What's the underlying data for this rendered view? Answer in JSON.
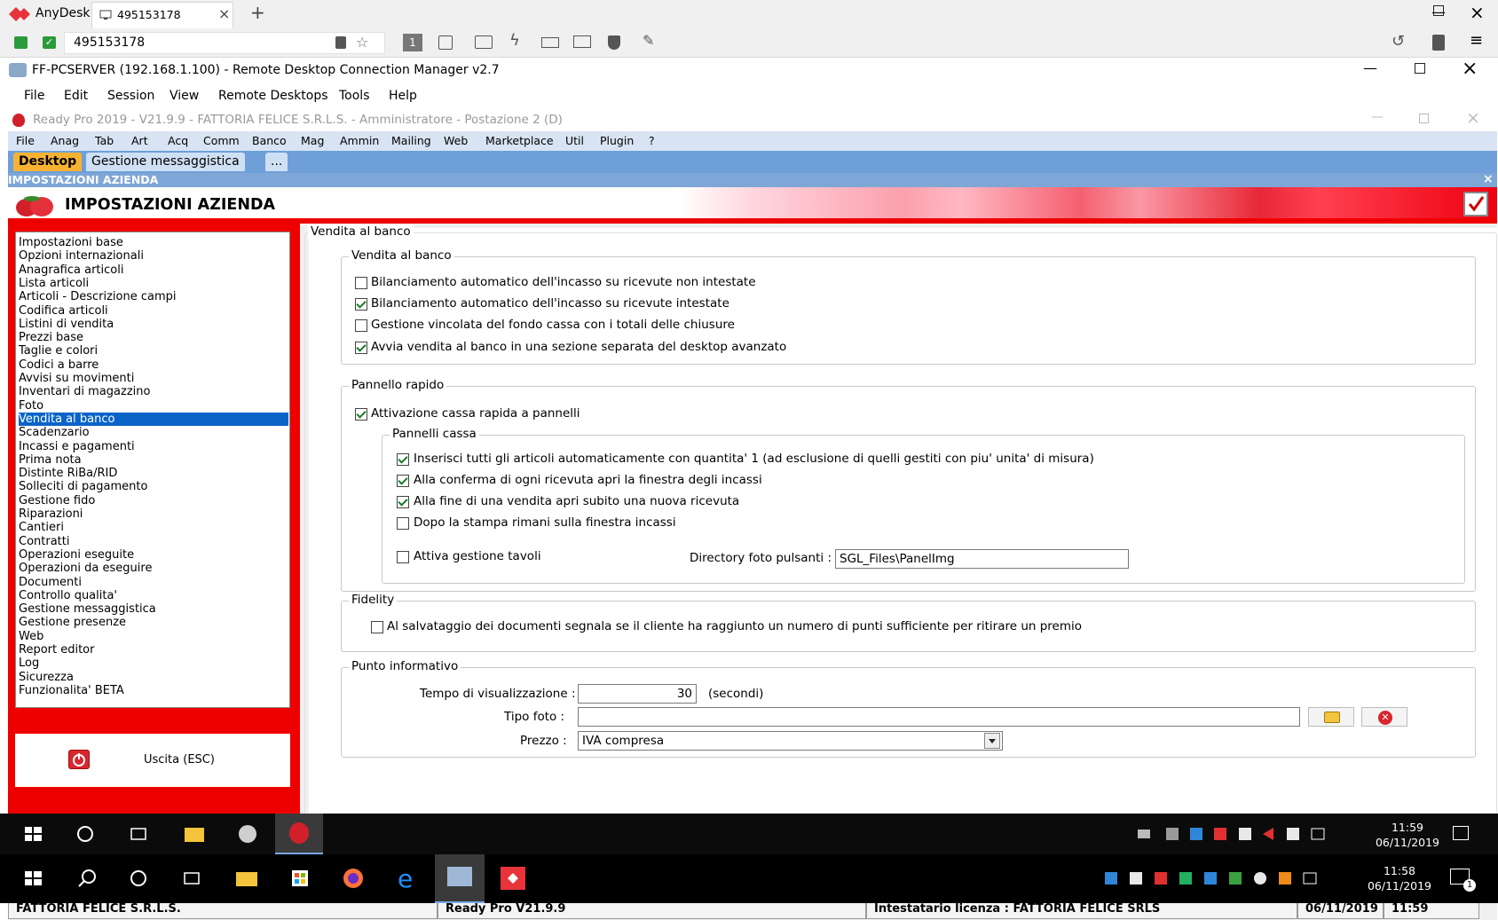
{
  "anydesk": {
    "app_name": "AnyDesk",
    "tab_label": "495153178",
    "address": "495153178",
    "new_tab": "+",
    "tool_monitor_badge": "1"
  },
  "rdcman": {
    "title": "FF-PCSERVER (192.168.1.100) - Remote Desktop Connection Manager v2.7",
    "menu": [
      "File",
      "Edit",
      "Session",
      "View",
      "Remote Desktops",
      "Tools",
      "Help"
    ]
  },
  "readypro": {
    "title": "Ready Pro 2019 - V21.9.9 - FATTORIA FELICE S.R.L.S. - Amministratore - Postazione 2 (D)",
    "menu": [
      "File",
      "Anag",
      "Tab",
      "Art",
      "Acq",
      "Comm",
      "Banco",
      "Mag",
      "Ammin",
      "Mailing",
      "Web",
      "Marketplace",
      "Util",
      "Plugin",
      "?"
    ],
    "tabs": [
      "Desktop",
      "Gestione messaggistica",
      "..."
    ],
    "section_title": "IMPOSTAZIONI AZIENDA",
    "banner_title": "IMPOSTAZIONI AZIENDA",
    "nav_items": [
      "Impostazioni base",
      "Opzioni internazionali",
      "Anagrafica articoli",
      "Lista articoli",
      "Articoli - Descrizione campi",
      "Codifica articoli",
      "Listini di vendita",
      "Prezzi base",
      "Taglie e colori",
      "Codici a barre",
      "Avvisi su movimenti",
      "Inventari di magazzino",
      "Foto",
      "Vendita al banco",
      "Scadenzario",
      "Incassi e pagamenti",
      "Prima nota",
      "Distinte RiBa/RID",
      "Solleciti di pagamento",
      "Gestione fido",
      "Riparazioni",
      "Cantieri",
      "Contratti",
      "Operazioni eseguite",
      "Operazioni da eseguire",
      "Documenti",
      "Controllo qualita'",
      "Gestione messaggistica",
      "Gestione presenze",
      "Web",
      "Report editor",
      "Log",
      "Sicurezza",
      "Funzionalita' BETA"
    ],
    "selected_nav_index": 13,
    "exit_label": "Uscita (ESC)",
    "panel_title": "Vendita al banco",
    "group_vendita": {
      "title": "Vendita al banco",
      "options": [
        {
          "label": "Bilanciamento automatico dell'incasso su ricevute non intestate",
          "checked": false
        },
        {
          "label": "Bilanciamento automatico dell'incasso su ricevute intestate",
          "checked": true
        },
        {
          "label": "Gestione vincolata del fondo cassa con i totali delle chiusure",
          "checked": false
        },
        {
          "label": "Avvia vendita al banco in una sezione separata del desktop avanzato",
          "checked": true
        }
      ]
    },
    "group_pannello": {
      "title": "Pannello rapido",
      "activation": {
        "label": "Attivazione cassa rapida a pannelli",
        "checked": true
      },
      "sub_title": "Pannelli cassa",
      "options": [
        {
          "label": "Inserisci tutti gli articoli automaticamente con quantita' 1 (ad esclusione di quelli gestiti con piu' unita' di misura)",
          "checked": true
        },
        {
          "label": "Alla conferma di ogni ricevuta apri la finestra degli incassi",
          "checked": true
        },
        {
          "label": "Alla fine di una vendita apri subito una nuova ricevuta",
          "checked": true
        },
        {
          "label": "Dopo la stampa rimani sulla finestra incassi",
          "checked": false
        }
      ],
      "tavoli": {
        "label": "Attiva gestione tavoli",
        "checked": false
      },
      "dir_label": "Directory foto pulsanti :",
      "dir_value": "SGL_Files\\PanelImg"
    },
    "group_fidelity": {
      "title": "Fidelity",
      "option": {
        "label": "Al salvataggio dei documenti segnala se il cliente ha raggiunto un numero di punti sufficiente per ritirare un premio",
        "checked": false
      }
    },
    "group_punto": {
      "title": "Punto informativo",
      "tempo_label": "Tempo di visualizzazione :",
      "tempo_value": "30",
      "tempo_unit": "(secondi)",
      "tipo_label": "Tipo foto :",
      "tipo_value": "",
      "prezzo_label": "Prezzo :",
      "prezzo_value": "IVA compresa"
    },
    "status": {
      "company": "FATTORIA FELICE S.R.L.S.",
      "version": "Ready Pro V21.9.9",
      "license": "Intestatario licenza : FATTORIA FELICE SRLS",
      "date": "06/11/2019",
      "time": "11:59"
    }
  },
  "taskbar_remote": {
    "time": "11:59",
    "date": "06/11/2019"
  },
  "taskbar_local": {
    "time": "11:58",
    "date": "06/11/2019",
    "notif_count": "1"
  },
  "colors": {
    "accent_red": "#ee0000",
    "menu_blue": "#d8e4f4",
    "tab_blue": "#6e9fd8",
    "selection": "#0a64c8"
  }
}
